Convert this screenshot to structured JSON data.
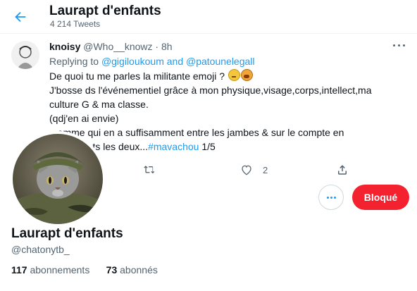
{
  "header": {
    "title": "Laurapt d'enfants",
    "tweet_count": "4 214 Tweets",
    "back_icon": "arrow-left-icon"
  },
  "tweet": {
    "author_name": "knoisy",
    "author_handle": "@Who__knowz",
    "separator": "·",
    "time": "8h",
    "replying_prefix": "Replying to ",
    "replying_mentions": "@gigiloukoum and @patounelegall",
    "body_lines": [
      "De quoi tu me parles la militante emoji ?",
      "J'bosse ds l'événementiel grâce à mon physique,visage,corps,intellect,ma",
      "culture G & ma classe.",
      "(qdj'en ai envie)",
      "...omme qui en a suffisamment entre les jambes & sur le compte en",
      "...ns ravir ts les deux...",
      "1/5"
    ],
    "hashtag": "#mavachou",
    "like_count": "2"
  },
  "profile": {
    "name": "Laurapt d'enfants",
    "handle": "@chatonytb_",
    "following_count": "117",
    "following_label": "abonnements",
    "followers_count": "73",
    "followers_label": "abonnés",
    "blocked_label": "Bloqué"
  },
  "colors": {
    "accent": "#1d9bf0",
    "blocked": "#f4212e",
    "secondary_text": "#536471"
  }
}
